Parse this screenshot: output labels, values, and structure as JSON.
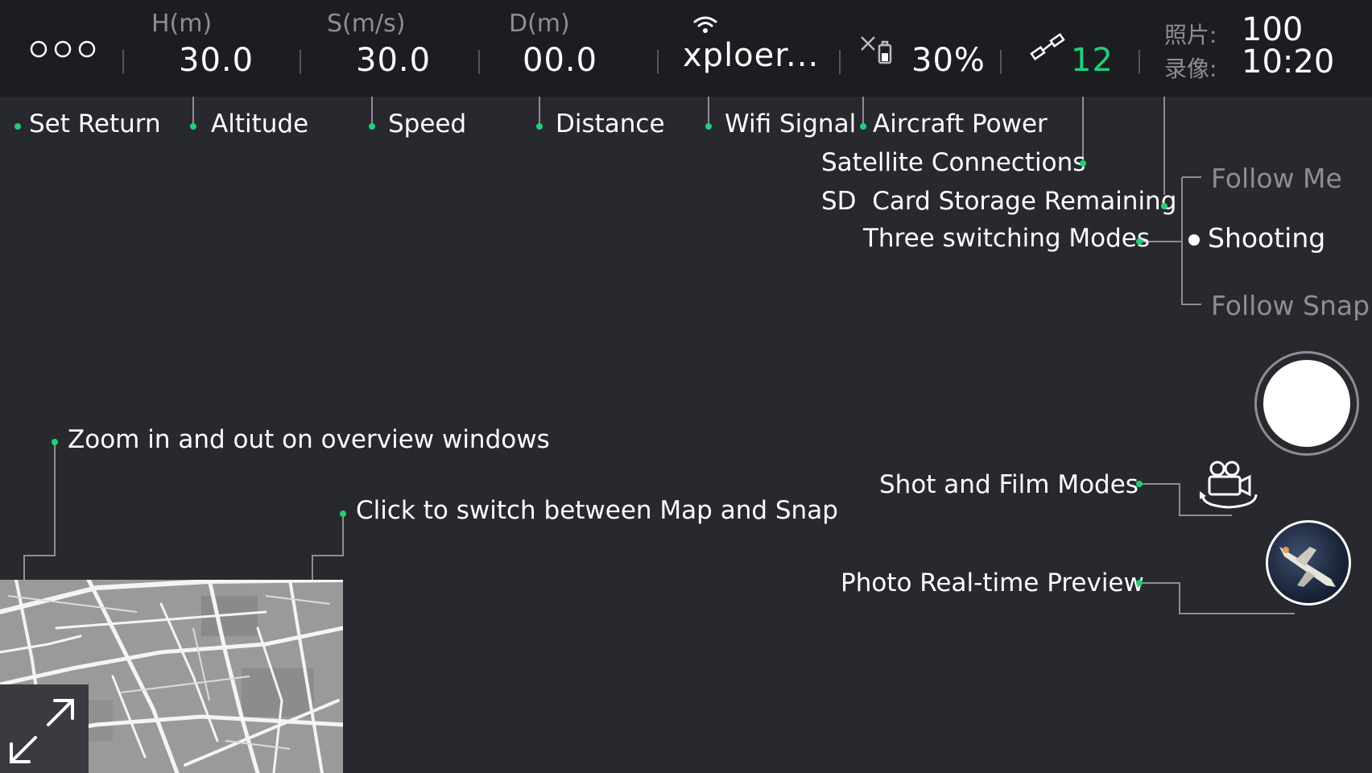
{
  "topbar": {
    "set_return_icon": "three-circles-icon",
    "altitude": {
      "caption": "H(m)",
      "value": "30.0"
    },
    "speed": {
      "caption": "S(m/s)",
      "value": "30.0"
    },
    "distance": {
      "caption": "D(m)",
      "value": "00.0"
    },
    "wifi": {
      "icon": "wifi-icon",
      "ssid": "xploer..."
    },
    "aircraft_power": {
      "icon": "drone-battery-icon",
      "value": "30%"
    },
    "satellites": {
      "icon": "satellite-icon",
      "count": "12"
    },
    "sd_card": {
      "photo_label": "照片:",
      "photo_count": "100",
      "video_label": "录像:",
      "video_time": "10:20"
    }
  },
  "annotations": {
    "set_return": "Set Return",
    "altitude": "Altitude",
    "speed": "Speed",
    "distance": "Distance",
    "wifi": "Wifi Signal",
    "aircraft_power": "Aircraft Power",
    "satellites": "Satellite Connections",
    "sd_card": "SD  Card Storage Remaining",
    "modes": "Three switching Modes",
    "zoom": "Zoom in and out on overview windows",
    "switch": "Click to switch between Map and Snap",
    "shot_film": "Shot and Film Modes",
    "preview": "Photo Real-time Preview"
  },
  "modes": {
    "items": [
      "Follow Me",
      "Shooting",
      "Follow Snap"
    ],
    "selected": "Shooting"
  },
  "controls": {
    "shutter_icon": "shutter-button-icon",
    "camera_mode_icon": "video-camera-rotate-icon",
    "preview_icon": "aircraft-thumbnail-icon",
    "expand_icon": "expand-arrows-icon"
  },
  "minimap": {
    "type": "street-map"
  },
  "colors": {
    "accent": "#1fd07a",
    "background": "#28292e",
    "topbar": "#1c1d21",
    "line": "#8d8e93"
  }
}
